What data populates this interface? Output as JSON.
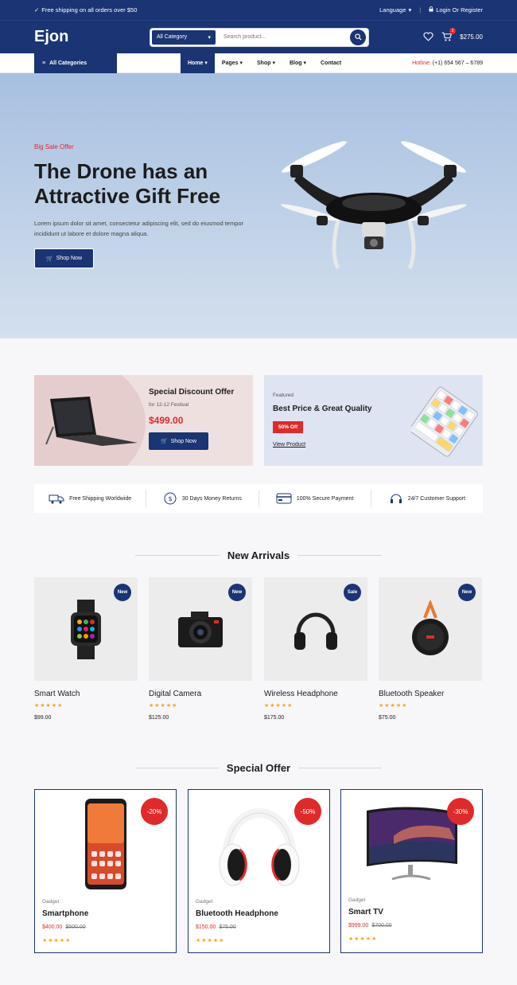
{
  "topbar": {
    "shipping_text": "Free shipping on all orders over $50",
    "language": "Language",
    "login": "Login Or Register"
  },
  "header": {
    "logo": "Ejon",
    "category_select": "All Category",
    "search_placeholder": "Search product...",
    "cart_count": "2",
    "cart_total": "$275.00"
  },
  "nav": {
    "all_categories": "All Categories",
    "links": [
      "Home",
      "Pages",
      "Shop",
      "Blog",
      "Contact"
    ],
    "hotline_label": "Hotline:",
    "hotline_number": "(+1) 654 567 – 6789"
  },
  "hero": {
    "tag": "Big Sale Offer",
    "title": "The Drone has an Attractive Gift Free",
    "description": "Lorem ipsum dolor sit amet, consectetur adipiscing elit, sed do eiusmod tempor incididunt ut labore et dolore magna aliqua.",
    "button": "Shop Now"
  },
  "promo1": {
    "title": "Special Discount Offer",
    "subtitle": "for 12-12 Festival",
    "price": "$499.00",
    "button": "Shop Now"
  },
  "promo2": {
    "tag": "Featured",
    "title": "Best Price & Great Quality",
    "badge": "50% Off",
    "link": "View Product"
  },
  "features": [
    "Free Shipping Worldwide",
    "30 Days Money Returns",
    "100% Secure Payment",
    "24/7 Customer Support"
  ],
  "new_arrivals": {
    "title": "New Arrivals",
    "items": [
      {
        "name": "Smart Watch",
        "price": "$99.00",
        "badge": "New"
      },
      {
        "name": "Digital Camera",
        "price": "$125.00",
        "badge": "New"
      },
      {
        "name": "Wireless Headphone",
        "price": "$175.00",
        "badge": "Sale"
      },
      {
        "name": "Bluetooth Speaker",
        "price": "$75.00",
        "badge": "New"
      }
    ]
  },
  "special_offer": {
    "title": "Special Offer",
    "items": [
      {
        "category": "Gadget",
        "name": "Smartphone",
        "price": "$400.00",
        "old_price": "$500.00",
        "discount": "-20%"
      },
      {
        "category": "Gadget",
        "name": "Bluetooth Headphone",
        "price": "$150.00",
        "old_price": "$75.00",
        "discount": "-50%"
      },
      {
        "category": "Gadget",
        "name": "Smart TV",
        "price": "$999.00",
        "old_price": "$700.00",
        "discount": "-30%"
      }
    ]
  },
  "rating_stars": "★★★★★",
  "colors": {
    "primary": "#1a3474",
    "accent": "#e02a2a",
    "star": "#f5a623"
  }
}
